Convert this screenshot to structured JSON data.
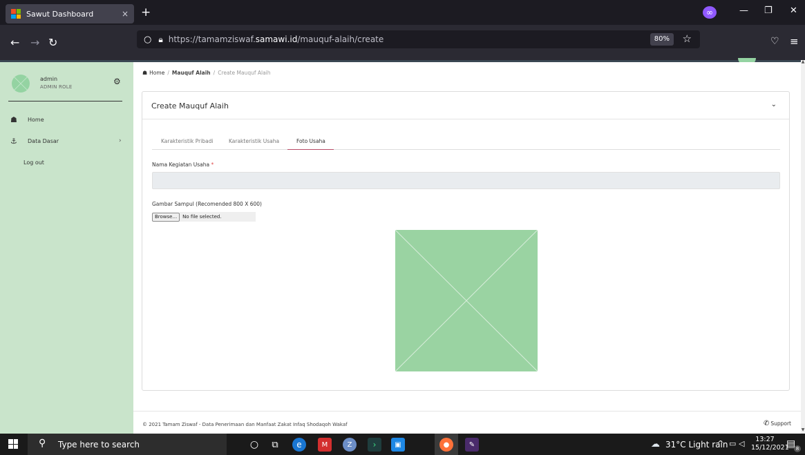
{
  "browser": {
    "tab_title": "Sawut Dashboard",
    "tab_close": "×",
    "new_tab": "+",
    "url_prefix": "https://tamamziswaf.",
    "url_domain": "samawi.id",
    "url_path": "/mauquf-alaih/create",
    "zoom": "80%",
    "window_minimize": "—",
    "window_restore": "❐",
    "window_close": "✕"
  },
  "sidebar": {
    "user_name": "admin",
    "user_role": "ADMIN ROLE",
    "items": [
      {
        "label": "Home",
        "icon": "home-icon"
      },
      {
        "label": "Data Dasar",
        "icon": "anchor-icon"
      },
      {
        "label": "Log out"
      }
    ]
  },
  "breadcrumb": {
    "home": "Home",
    "section": "Mauquf Alaih",
    "current": "Create Mauquf Alaih"
  },
  "card": {
    "title": "Create Mauquf Alaih",
    "tabs": [
      {
        "label": "Karakteristik Pribadi",
        "active": false
      },
      {
        "label": "Karakteristik Usaha",
        "active": false
      },
      {
        "label": "Foto Usaha",
        "active": true
      }
    ],
    "field_name_label": "Nama Kegiatan Usaha",
    "field_name_required": "*",
    "field_name_value": "",
    "cover_label": "Gambar Sampul (Recomended 800 X 600)",
    "browse_label": "Browse...",
    "file_status": "No file selected."
  },
  "footer": {
    "text": "© 2021 Tamam Ziswaf - Data Penerimaan dan Manfaat Zakat Infaq Shodaqoh Wakaf",
    "support": "Support"
  },
  "taskbar": {
    "search_placeholder": "Type here to search",
    "weather": "31°C  Light rain",
    "time": "13:27",
    "date": "15/12/2021",
    "notifications": "8"
  },
  "colors": {
    "sidebar_bg": "#c9e4cb",
    "placeholder_green": "#94d3a2",
    "active_tab_underline": "#b84a66",
    "required_red": "#e04b4b"
  }
}
